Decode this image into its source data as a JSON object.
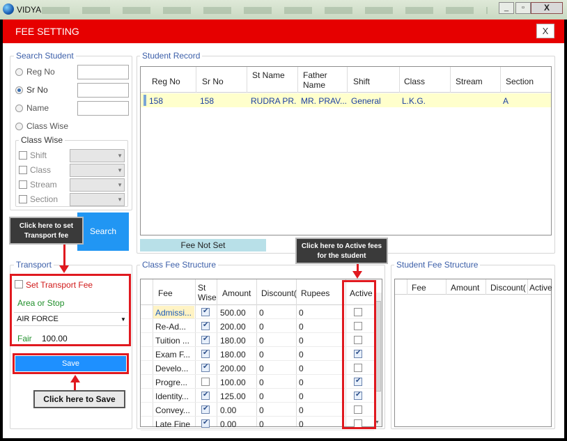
{
  "window": {
    "title": "VIDYA",
    "close_glyph": "X",
    "min_glyph": "_",
    "max_glyph": "▫"
  },
  "header": {
    "title": "FEE SETTING",
    "close_label": "X"
  },
  "search": {
    "legend": "Search Student",
    "options": [
      "Reg No",
      "Sr No",
      "Name",
      "Class Wise"
    ],
    "selected": "Sr No",
    "class_wise": {
      "legend": "Class Wise",
      "fields": [
        "Shift",
        "Class",
        "Stream",
        "Section"
      ]
    },
    "search_button": "Search"
  },
  "student_record": {
    "legend": "Student Record",
    "columns": [
      "Reg No",
      "Sr No",
      "St Name",
      "Father Name",
      "Shift",
      "Class",
      "Stream",
      "Section"
    ],
    "rows": [
      [
        "158",
        "158",
        "RUDRA PR...",
        "MR. PRAV...",
        "General",
        "L.K.G.",
        "",
        "A"
      ]
    ]
  },
  "fee_not_set": "Fee Not Set",
  "transport": {
    "legend": "Transport",
    "set_label": "Set Transport Fee",
    "area_label": "Area or Stop",
    "area_value": "AIR FORCE",
    "fair_label": "Fair",
    "fair_value": "100.00",
    "save_button": "Save"
  },
  "class_fee": {
    "legend": "Class Fee Structure",
    "columns": [
      "Fee",
      "St Wise",
      "Amount",
      "Discount(",
      "Rupees",
      "Active"
    ],
    "rows": [
      {
        "fee": "Admissi...",
        "st_wise": true,
        "amount": "500.00",
        "discount": "0",
        "rupees": "0",
        "active": false
      },
      {
        "fee": "Re-Ad...",
        "st_wise": true,
        "amount": "200.00",
        "discount": "0",
        "rupees": "0",
        "active": false
      },
      {
        "fee": "Tuition ...",
        "st_wise": true,
        "amount": "180.00",
        "discount": "0",
        "rupees": "0",
        "active": false
      },
      {
        "fee": "Exam F...",
        "st_wise": true,
        "amount": "180.00",
        "discount": "0",
        "rupees": "0",
        "active": true
      },
      {
        "fee": "Develo...",
        "st_wise": true,
        "amount": "200.00",
        "discount": "0",
        "rupees": "0",
        "active": false
      },
      {
        "fee": "Progre...",
        "st_wise": false,
        "amount": "100.00",
        "discount": "0",
        "rupees": "0",
        "active": true
      },
      {
        "fee": "Identity...",
        "st_wise": true,
        "amount": "125.00",
        "discount": "0",
        "rupees": "0",
        "active": true
      },
      {
        "fee": "Convey...",
        "st_wise": true,
        "amount": "0.00",
        "discount": "0",
        "rupees": "0",
        "active": false
      },
      {
        "fee": "Late Fine",
        "st_wise": true,
        "amount": "0.00",
        "discount": "0",
        "rupees": "0",
        "active": false
      }
    ]
  },
  "student_fee": {
    "legend": "Student Fee Structure",
    "columns": [
      "Fee",
      "Amount",
      "Discount(",
      "Active"
    ]
  },
  "callouts": {
    "transport": "Click here to set Transport fee",
    "active": "Click here to Active fees for the student",
    "save": "Click here to Save"
  },
  "colors": {
    "header_red": "#e60000",
    "save_blue": "#1e90ff",
    "highlight_row": "#ffffcc",
    "annotation_red": "#e0191f"
  }
}
